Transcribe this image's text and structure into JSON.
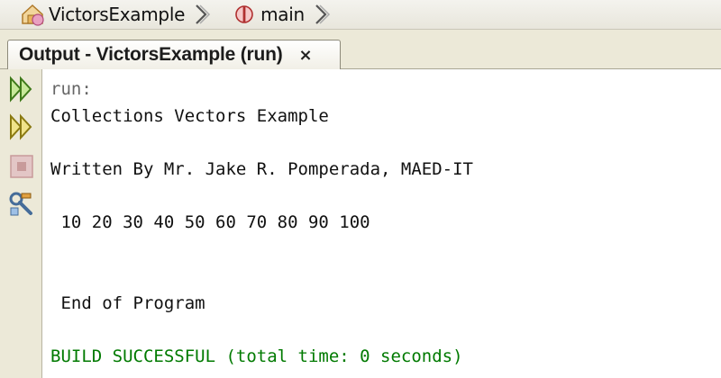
{
  "breadcrumb": {
    "items": [
      {
        "label": "VictorsExample",
        "icon": "project-icon"
      },
      {
        "label": "main",
        "icon": "method-icon"
      }
    ]
  },
  "output_tab": {
    "title": "Output - VictorsExample (run)",
    "close_glyph": "×"
  },
  "toolbar": {
    "buttons": [
      "rerun-icon",
      "rerun-with-options-icon",
      "stop-icon",
      "settings-icon"
    ]
  },
  "output": {
    "lines": [
      "run:",
      "Collections Vectors Example",
      "Written By Mr. Jake R. Pomperada, MAED-IT",
      " 10 20 30 40 50 60 70 80 90 100",
      " End of Program",
      "BUILD SUCCESSFUL (total time: 0 seconds)"
    ]
  },
  "colors": {
    "success": "#007a00",
    "run_label": "#666666"
  }
}
